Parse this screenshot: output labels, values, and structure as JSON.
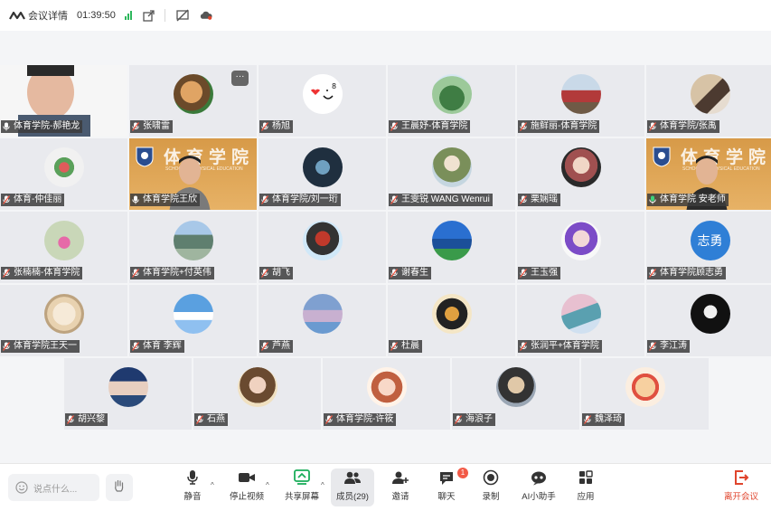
{
  "topbar": {
    "title": "会议详情",
    "time": "01:39:50"
  },
  "participants": [
    {
      "name": "体育学院-郝艳龙"
    },
    {
      "name": "张啸雷"
    },
    {
      "name": "杨旭"
    },
    {
      "name": "王晨妤-体育学院"
    },
    {
      "name": "施鲜丽-体育学院"
    },
    {
      "name": "体育学院/张禹"
    },
    {
      "name": "体育-仲佳丽"
    },
    {
      "name": "体育学院王欣"
    },
    {
      "name": "体育学院/刘一珩"
    },
    {
      "name": "王雯锐 WANG Wenrui"
    },
    {
      "name": "栗娴瑶"
    },
    {
      "name": "体育学院 安老师"
    },
    {
      "name": "张楠楠-体育学院"
    },
    {
      "name": "体育学院+付英伟"
    },
    {
      "name": "胡飞"
    },
    {
      "name": "谢春生"
    },
    {
      "name": "王玉强"
    },
    {
      "name": "体育学院顾志勇",
      "avatar_text": "志勇"
    },
    {
      "name": "体育学院王天一"
    },
    {
      "name": "体育 李辉"
    },
    {
      "name": "芦燕"
    },
    {
      "name": "杜晨"
    },
    {
      "name": "张润平+体育学院"
    },
    {
      "name": "李江涛"
    },
    {
      "name": "胡兴黎"
    },
    {
      "name": "石燕"
    },
    {
      "name": "体育学院-许筱"
    },
    {
      "name": "海浪子"
    },
    {
      "name": "魏泽琦"
    }
  ],
  "video_banner": {
    "text": "体育学院",
    "subtext": "SCHOOL OF PHYSICAL EDUCATION"
  },
  "more_label": "···",
  "toolbar": {
    "chat_placeholder": "说点什么...",
    "mute": "静音",
    "stop_video": "停止视频",
    "share_screen": "共享屏幕",
    "members": "成员(29)",
    "invite": "邀请",
    "chat": "聊天",
    "chat_badge": "1",
    "record": "录制",
    "ai_assistant": "AI小助手",
    "apps": "应用",
    "leave": "离开会议"
  },
  "colors": {
    "accent_green": "#2db75c",
    "leave_red": "#e0452d",
    "badge_red": "#f25a47",
    "active_outline": "#6fd49a"
  }
}
